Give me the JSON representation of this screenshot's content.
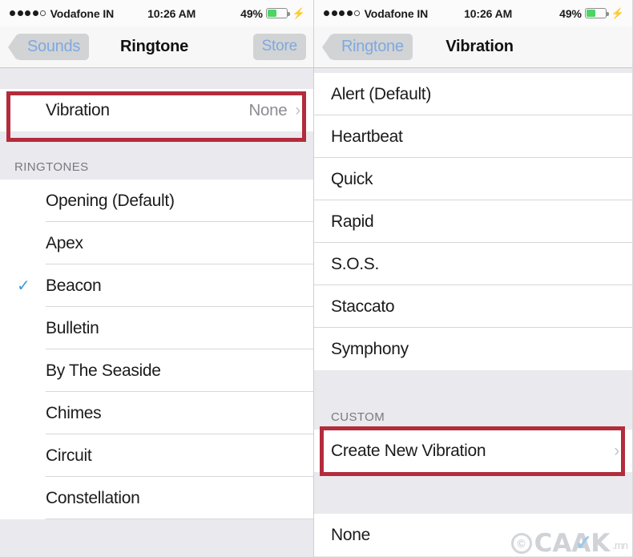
{
  "status_bar": {
    "signal_dots_filled": 4,
    "signal_dots_total": 5,
    "carrier": "Vodafone IN",
    "time": "10:26 AM",
    "battery_percent": "49%",
    "battery_level": 49,
    "charging_icon": "lightning-bolt-icon",
    "battery_color": "#4cd464"
  },
  "left_screen": {
    "nav": {
      "back_label": "Sounds",
      "title": "Ringtone",
      "right_button_label": "Store"
    },
    "vibration_row": {
      "label": "Vibration",
      "value": "None",
      "chevron": "›",
      "highlighted": true
    },
    "section_header": "RINGTONES",
    "ringtones": [
      {
        "label": "Opening (Default)",
        "selected": false
      },
      {
        "label": "Apex",
        "selected": false
      },
      {
        "label": "Beacon",
        "selected": true
      },
      {
        "label": "Bulletin",
        "selected": false
      },
      {
        "label": "By The Seaside",
        "selected": false
      },
      {
        "label": "Chimes",
        "selected": false
      },
      {
        "label": "Circuit",
        "selected": false
      },
      {
        "label": "Constellation",
        "selected": false
      }
    ],
    "checkmark_glyph": "✓"
  },
  "right_screen": {
    "nav": {
      "back_label": "Ringtone",
      "title": "Vibration"
    },
    "standard_patterns": [
      "Alert (Default)",
      "Heartbeat",
      "Quick",
      "Rapid",
      "S.O.S.",
      "Staccato",
      "Symphony"
    ],
    "section_header": "CUSTOM",
    "create_row": {
      "label": "Create New Vibration",
      "chevron": "›",
      "highlighted": true
    },
    "none_row": {
      "label": "None"
    }
  },
  "annotation": {
    "box_color": "#b32c3c",
    "box_count": 2
  },
  "watermark": {
    "copyright_glyph": "©",
    "brand": "CAAK",
    "tick": "✓",
    "suffix": ".mn"
  }
}
